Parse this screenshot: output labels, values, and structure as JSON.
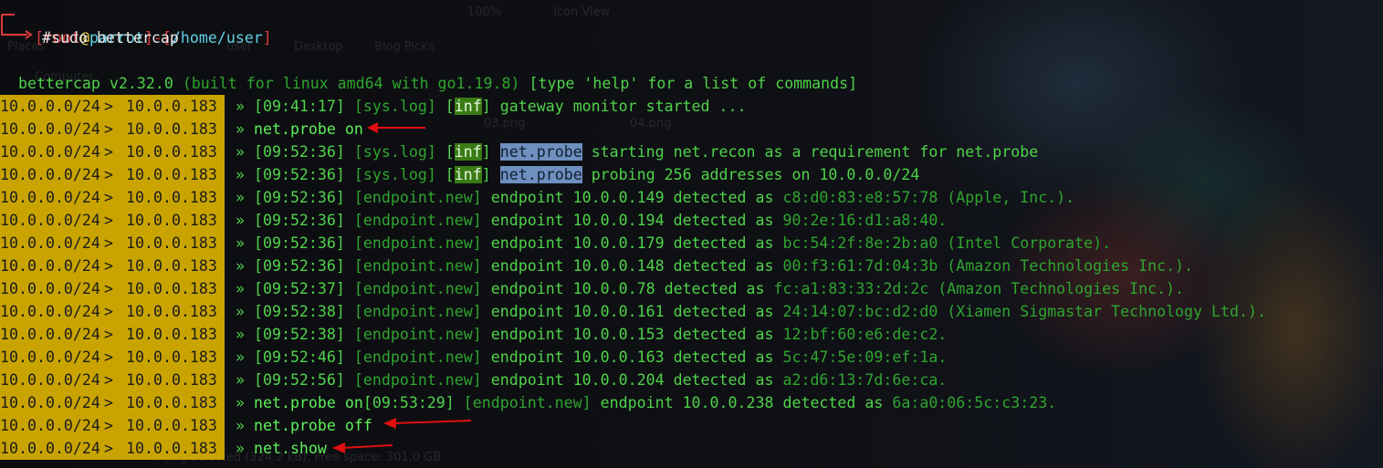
{
  "prompt": {
    "user": "root",
    "at": "@",
    "host": "parrot",
    "path": "/home/user",
    "command": "#sudo bettercap"
  },
  "banner": {
    "version": "bettercap v2.32.0",
    "built": "(built for linux amd64 with go1.19.8)",
    "help": "[type 'help' for a list of commands]"
  },
  "session_prompt": {
    "subnet": "10.0.0.0/24",
    "sep": ">",
    "ip": "10.0.0.183"
  },
  "lines": [
    {
      "type": "log",
      "ts": "[09:41:17]",
      "tag": "[sys.log]",
      "lvl": "inf",
      "mod": "",
      "msg": "gateway monitor started ..."
    },
    {
      "type": "cmd",
      "text": "net.probe on"
    },
    {
      "type": "log",
      "ts": "[09:52:36]",
      "tag": "[sys.log]",
      "lvl": "inf",
      "mod": "net.probe",
      "msg": "starting net.recon as a requirement for net.probe"
    },
    {
      "type": "log",
      "ts": "[09:52:36]",
      "tag": "[sys.log]",
      "lvl": "inf",
      "mod": "net.probe",
      "msg": "probing 256 addresses on 10.0.0.0/24"
    },
    {
      "type": "ep",
      "ts": "[09:52:36]",
      "ip": "10.0.0.149",
      "mac": "c8:d0:83:e8:57:78",
      "vendor": "(Apple, Inc.)."
    },
    {
      "type": "ep",
      "ts": "[09:52:36]",
      "ip": "10.0.0.194",
      "mac": "90:2e:16:d1:a8:40.",
      "vendor": ""
    },
    {
      "type": "ep",
      "ts": "[09:52:36]",
      "ip": "10.0.0.179",
      "mac": "bc:54:2f:8e:2b:a0",
      "vendor": "(Intel Corporate)."
    },
    {
      "type": "ep",
      "ts": "[09:52:36]",
      "ip": "10.0.0.148",
      "mac": "00:f3:61:7d:04:3b",
      "vendor": "(Amazon Technologies Inc.)."
    },
    {
      "type": "ep",
      "ts": "[09:52:37]",
      "ip": "10.0.0.78",
      "mac": "fc:a1:83:33:2d:2c",
      "vendor": "(Amazon Technologies Inc.)."
    },
    {
      "type": "ep",
      "ts": "[09:52:38]",
      "ip": "10.0.0.161",
      "mac": "24:14:07:bc:d2:d0",
      "vendor": "(Xiamen Sigmastar Technology Ltd.)."
    },
    {
      "type": "ep",
      "ts": "[09:52:38]",
      "ip": "10.0.0.153",
      "mac": "12:bf:60:e6:de:c2.",
      "vendor": ""
    },
    {
      "type": "ep",
      "ts": "[09:52:46]",
      "ip": "10.0.0.163",
      "mac": "5c:47:5e:09:ef:1a.",
      "vendor": ""
    },
    {
      "type": "ep",
      "ts": "[09:52:56]",
      "ip": "10.0.0.204",
      "mac": "a2:d6:13:7d:6e:ca.",
      "vendor": ""
    },
    {
      "type": "cmdep",
      "cmd": "net.probe on",
      "ts": "[09:53:29]",
      "ip": "10.0.0.238",
      "mac": "6a:a0:06:5c:c3:23.",
      "vendor": ""
    },
    {
      "type": "cmd",
      "text": "net.probe off"
    },
    {
      "type": "cmd",
      "text": "net.show"
    }
  ],
  "words": {
    "marker": "»",
    "endpoint_new": "[endpoint.new]",
    "endpoint": "endpoint",
    "detected_as": "detected as"
  },
  "background_ghost": [
    "Places",
    "Computer",
    "user",
    "Desktop",
    "Blog Picks",
    "03.png",
    "04.png",
    "100%",
    "Icon View",
    "7 png selected (324.2 kB), Free space: 301.0 GB"
  ],
  "colors": {
    "prompt_bg": "#c9a400",
    "green": "#4fd34a",
    "red": "#e0383b",
    "cyan": "#5fd0e6",
    "inf_bg": "#3a7b14",
    "highlight_bg": "#6e8fbf",
    "arrow": "#e01010"
  }
}
